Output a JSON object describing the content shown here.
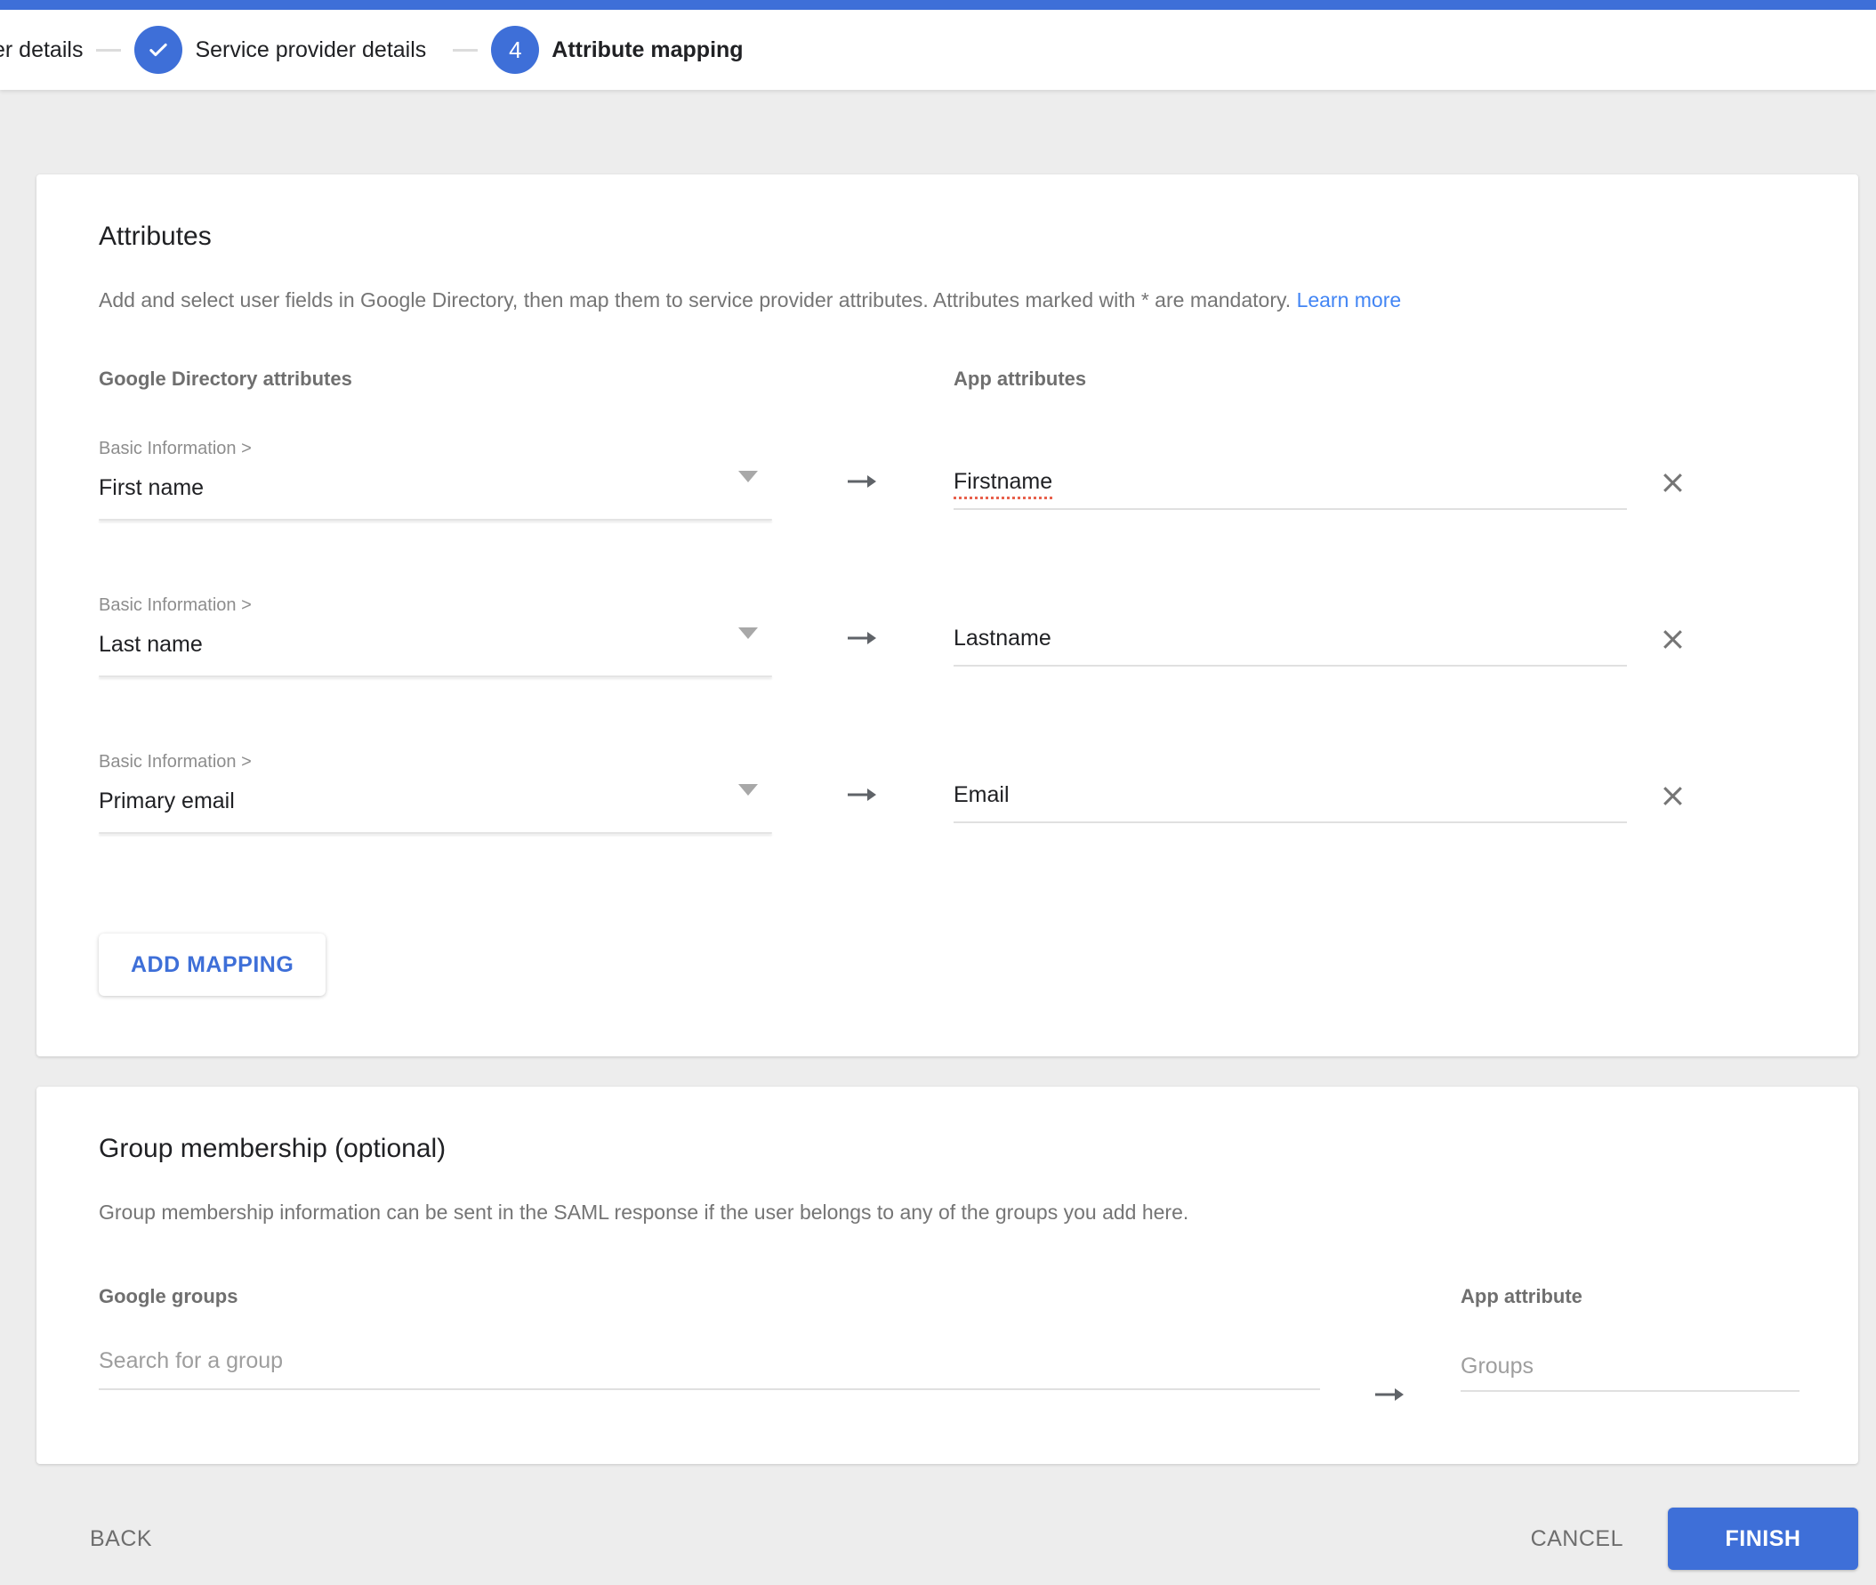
{
  "colors": {
    "accent_blue": "#3e6fd8",
    "link_blue": "#4285f4",
    "text_primary": "#202124",
    "text_secondary": "#757575",
    "placeholder": "#9e9e9e",
    "underline": "#e0e0e0",
    "page_background": "#ededed",
    "spellcheck_red": "#e8604c"
  },
  "stepper": {
    "truncated_label": "er details",
    "completed_step": {
      "label": "Service provider details",
      "icon": "check"
    },
    "current_step": {
      "number": "4",
      "label": "Attribute mapping"
    }
  },
  "attributes_card": {
    "title": "Attributes",
    "description": "Add and select user fields in Google Directory, then map them to service provider attributes. Attributes marked with * are mandatory.",
    "learn_more_label": "Learn more",
    "left_column_header": "Google Directory attributes",
    "right_column_header": "App attributes",
    "mappings": [
      {
        "category": "Basic Information >",
        "directory_attribute": "First name",
        "app_attribute": "Firstname",
        "spellcheck_underline": true
      },
      {
        "category": "Basic Information >",
        "directory_attribute": "Last name",
        "app_attribute": "Lastname",
        "spellcheck_underline": false
      },
      {
        "category": "Basic Information >",
        "directory_attribute": "Primary email",
        "app_attribute": "Email",
        "spellcheck_underline": false
      }
    ],
    "add_mapping_label": "ADD MAPPING"
  },
  "group_membership_card": {
    "title": "Group membership (optional)",
    "description": "Group membership information can be sent in the SAML response if the user belongs to any of the groups you add here.",
    "google_groups_header": "Google groups",
    "app_attribute_header": "App attribute",
    "search_placeholder": "Search for a group",
    "app_attribute_placeholder": "Groups"
  },
  "footer": {
    "back_label": "BACK",
    "cancel_label": "CANCEL",
    "finish_label": "FINISH"
  }
}
